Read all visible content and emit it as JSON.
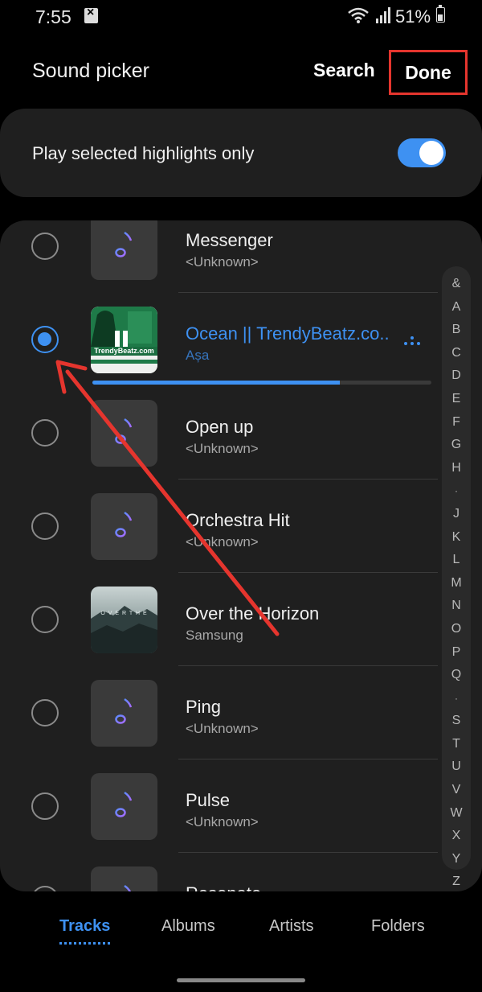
{
  "status_bar": {
    "time": "7:55",
    "battery": "51%"
  },
  "header": {
    "title": "Sound picker",
    "search_label": "Search",
    "done_label": "Done"
  },
  "highlights": {
    "label": "Play selected highlights only",
    "enabled": true
  },
  "tracks": [
    {
      "name": "Messenger",
      "artist": "<Unknown>",
      "selected": false
    },
    {
      "name": "Ocean || TrendyBeatz.co..",
      "artist": "Așa",
      "selected": true,
      "playback_progress": 0.73
    },
    {
      "name": "Open up",
      "artist": "<Unknown>",
      "selected": false
    },
    {
      "name": "Orchestra Hit",
      "artist": "<Unknown>",
      "selected": false
    },
    {
      "name": "Over the Horizon",
      "artist": "Samsung",
      "selected": false
    },
    {
      "name": "Ping",
      "artist": "<Unknown>",
      "selected": false
    },
    {
      "name": "Pulse",
      "artist": "<Unknown>",
      "selected": false
    },
    {
      "name": "Resonate",
      "artist": "",
      "selected": false
    }
  ],
  "album_art_text": {
    "ocean": "TrendyBeatz.com",
    "horizon": "O V E R  T H E"
  },
  "index_letters": [
    "&",
    "A",
    "B",
    "C",
    "D",
    "E",
    "F",
    "G",
    "H",
    "·",
    "J",
    "K",
    "L",
    "M",
    "N",
    "O",
    "P",
    "Q",
    "·",
    "S",
    "T",
    "U",
    "V",
    "W",
    "X",
    "Y",
    "Z"
  ],
  "tabs": [
    {
      "label": "Tracks",
      "active": true
    },
    {
      "label": "Albums",
      "active": false
    },
    {
      "label": "Artists",
      "active": false
    },
    {
      "label": "Folders",
      "active": false
    }
  ],
  "colors": {
    "accent": "#3e91f2",
    "annotation": "#e5352e"
  }
}
